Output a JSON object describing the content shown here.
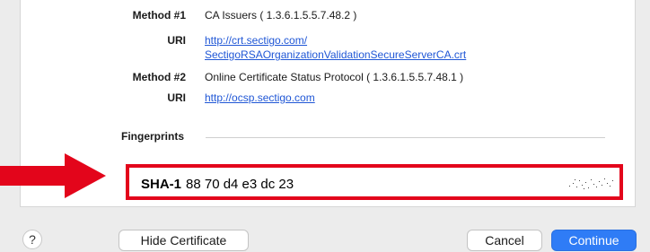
{
  "details": {
    "method1_label": "Method #1",
    "method1_value": "CA Issuers ( 1.3.6.1.5.5.7.48.2 )",
    "uri1_label": "URI",
    "uri1_line1": "http://crt.sectigo.com/",
    "uri1_line2": "SectigoRSAOrganizationValidationSecureServerCA.crt",
    "method2_label": "Method #2",
    "method2_value": "Online Certificate Status Protocol ( 1.3.6.1.5.5.7.48.1 )",
    "uri2_label": "URI",
    "uri2_value": "http://ocsp.sectigo.com"
  },
  "fingerprints": {
    "section_title": "Fingerprints",
    "sha1_label": "SHA-1",
    "sha1_value": "88 70 d4 e3 dc 23"
  },
  "footer": {
    "help_label": "?",
    "hide_certificate_label": "Hide Certificate",
    "cancel_label": "Cancel",
    "continue_label": "Continue"
  },
  "colors": {
    "highlight_red": "#e3051b",
    "link_blue": "#2057d6",
    "primary_button": "#2f7cf6"
  },
  "icons": {
    "arrow": "right-arrow-icon",
    "help": "help-icon"
  }
}
